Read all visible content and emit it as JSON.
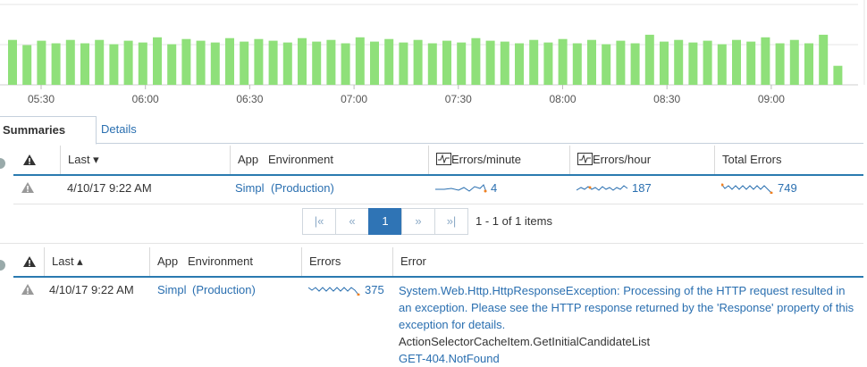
{
  "chart": {
    "x_ticks": [
      "05:30",
      "06:00",
      "06:30",
      "07:00",
      "07:30",
      "08:00",
      "08:30",
      "09:00"
    ],
    "bar_color": "#8fe07a",
    "values": [
      52,
      46,
      51,
      48,
      52,
      48,
      52,
      47,
      51,
      49,
      55,
      47,
      53,
      51,
      49,
      54,
      50,
      53,
      51,
      49,
      54,
      50,
      52,
      48,
      55,
      50,
      53,
      49,
      52,
      48,
      51,
      49,
      54,
      51,
      50,
      48,
      52,
      49,
      53,
      48,
      52,
      47,
      51,
      48,
      58,
      50,
      52,
      49,
      51,
      47,
      52,
      50,
      55,
      48,
      52,
      48,
      58,
      22
    ]
  },
  "tabs": {
    "summaries": "Summaries",
    "details": "Details"
  },
  "summary_table": {
    "headers": {
      "last": "Last ▾",
      "app": "App",
      "environment": "Environment",
      "errors_minute": "Errors/minute",
      "errors_hour": "Errors/hour",
      "total_errors": "Total Errors"
    },
    "row": {
      "last": "4/10/17 9:22 AM",
      "app": "Simpl",
      "environment": "(Production)",
      "errors_minute": "4",
      "errors_hour": "187",
      "total_errors": "749"
    }
  },
  "pager": {
    "first": "|«",
    "prev": "«",
    "page": "1",
    "next": "»",
    "last": "»|",
    "info": "1 - 1 of 1 items"
  },
  "detail_table": {
    "headers": {
      "last": "Last ▴",
      "app": "App",
      "environment": "Environment",
      "errors": "Errors",
      "error": "Error"
    },
    "row": {
      "last": "4/10/17 9:22 AM",
      "app": "Simpl",
      "environment": "(Production)",
      "errors": "375",
      "message": "System.Web.Http.HttpResponseException: Processing of the HTTP request resulted in an exception. Please see the HTTP response returned by the 'Response' property of this exception for details.",
      "method": "ActionSelectorCacheItem.GetInitialCandidateList",
      "code": "GET-404.NotFound"
    }
  },
  "colors": {
    "accent": "#2a6fb0",
    "header_underline": "#2a7ab0",
    "active_page": "#2f74b5"
  }
}
